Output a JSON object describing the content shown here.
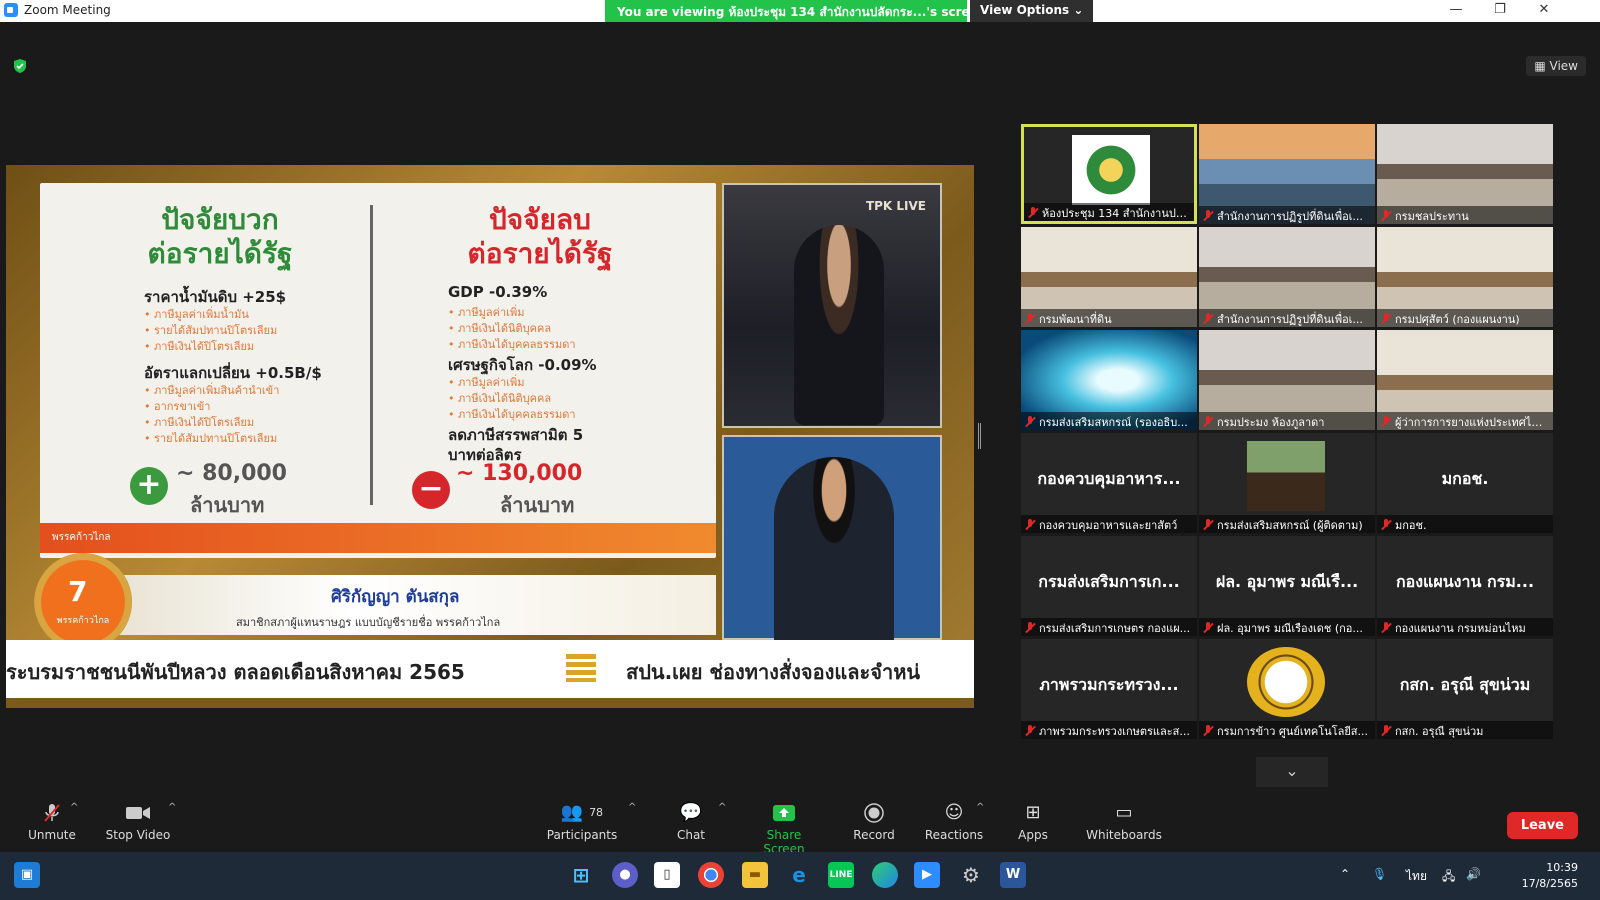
{
  "window": {
    "title": "Zoom Meeting"
  },
  "banner": {
    "message": "You are viewing ห้องประชุม 134 สำนักงานปลัดกระ...'s screen",
    "view_options": "View Options ⌄"
  },
  "view_button": "View",
  "slide": {
    "positive_heading_1": "ปัจจัยบวก",
    "positive_heading_2": "ต่อรายได้รัฐ",
    "negative_heading_1": "ปัจจัยลบ",
    "negative_heading_2": "ต่อรายได้รัฐ",
    "pos_item1": "ราคาน้ำมันดิบ +25$",
    "pos_item1_subs": [
      "• ภาษีมูลค่าเพิ่มน้ำมัน",
      "• รายได้สัมปทานปิโตรเลียม",
      "• ภาษีเงินได้ปิโตรเลียม"
    ],
    "pos_item2": "อัตราแลกเปลี่ยน +0.5B/$",
    "pos_item2_subs": [
      "• ภาษีมูลค่าเพิ่มสินค้านำเข้า",
      "• อากรขาเข้า",
      "• ภาษีเงินได้ปิโตรเลียม",
      "• รายได้สัมปทานปิโตรเลียม"
    ],
    "pos_total": "~ 80,000",
    "pos_unit": "ล้านบาท",
    "neg_item1": "GDP -0.39%",
    "neg_item1_subs": [
      "• ภาษีมูลค่าเพิ่ม",
      "• ภาษีเงินได้นิติบุคคล",
      "• ภาษีเงินได้บุคคลธรรมดา"
    ],
    "neg_item2": "เศรษฐกิจโลก -0.09%",
    "neg_item2_subs": [
      "• ภาษีมูลค่าเพิ่ม",
      "• ภาษีเงินได้นิติบุคคล",
      "• ภาษีเงินได้บุคคลธรรมดา"
    ],
    "neg_item3_line1": "ลดภาษีสรรพสามิต 5",
    "neg_item3_line2": "บาทต่อลิตร",
    "neg_total": "~ 130,000",
    "neg_unit": "ล้านบาท",
    "plus_sign": "+",
    "minus_sign": "−",
    "orange_bar_text": "พรรคก้าวไกล",
    "cam_tag": "TPK LIVE",
    "speaker_name": "ศิริกัญญา ตันสกุล",
    "speaker_title": "สมาชิกสภาผู้แทนราษฎร แบบบัญชีรายชื่อ พรรคก้าวไกล",
    "logo_text": "พรรคก้าวไกล",
    "logo_mark": "7",
    "ticker_left": "ระบรมราชชนนีพันปีหลวง ตลอดเดือนสิงหาคม 2565",
    "ticker_right": "สปน.เผย ช่องทางสั่งจองและจำหน่"
  },
  "participants": [
    {
      "label": "ห้องประชุม 134 สำนักงานปลัดก...",
      "big": "",
      "kind": "logo-green"
    },
    {
      "label": "สำนักงานการปฏิรูปที่ดินเพื่อเ...",
      "big": "",
      "kind": "video-person"
    },
    {
      "label": "กรมชลประทาน",
      "big": "",
      "kind": "video-room"
    },
    {
      "label": "กรมพัฒนาที่ดิน",
      "big": "",
      "kind": "video-room2"
    },
    {
      "label": "สำนักงานการปฏิรูปที่ดินเพื่อเ...",
      "big": "",
      "kind": "video-room"
    },
    {
      "label": "กรมปศุสัตว์ (กองแผนงาน)",
      "big": "",
      "kind": "video-room2"
    },
    {
      "label": "กรมส่งเสริมสหกรณ์ (รองอธิบ...",
      "big": "",
      "kind": "video-tunnel"
    },
    {
      "label": "กรมประมง ห้องภูลาดา",
      "big": "",
      "kind": "video-room"
    },
    {
      "label": "ผู้ว่าการการยางแห่งประเทศไท...",
      "big": "",
      "kind": "video-room2"
    },
    {
      "label": "กองควบคุมอาหารและยาสัตว์",
      "big": "กองควบคุมอาหาร...",
      "kind": "name"
    },
    {
      "label": "กรมส่งเสริมสหกรณ์ (ผู้ติดตาม)",
      "big": "",
      "kind": "plant"
    },
    {
      "label": "มกอช.",
      "big": "มกอช.",
      "kind": "name"
    },
    {
      "label": "กรมส่งเสริมการเกษตร กองแผ...",
      "big": "กรมส่งเสริมการเก...",
      "kind": "name"
    },
    {
      "label": "ฝล. อุมาพร มณีเรืองเดช (กอ...",
      "big": "ฝล. อุมาพร มณีเรื...",
      "kind": "name"
    },
    {
      "label": "กองแผนงาน กรมหม่อนไหม",
      "big": "กองแผนงาน กรม...",
      "kind": "name"
    },
    {
      "label": "ภาพรวมกระทรวงเกษตรและส...",
      "big": "ภาพรวมกระทรวง...",
      "kind": "name"
    },
    {
      "label": "กรมการข้าว ศูนย์เทคโนโลยีส...",
      "big": "",
      "kind": "logo-yellow"
    },
    {
      "label": "กสก. อรุณี สุขน่วม",
      "big": "กสก. อรุณี สุขน่วม",
      "kind": "name"
    }
  ],
  "toolbar": {
    "unmute": "Unmute",
    "stop_video": "Stop Video",
    "participants": "Participants",
    "participants_count": "78",
    "chat": "Chat",
    "share_screen": "Share Screen",
    "record": "Record",
    "reactions": "Reactions",
    "apps": "Apps",
    "whiteboards": "Whiteboards",
    "leave": "Leave"
  },
  "taskbar": {
    "time": "10:39",
    "date": "17/8/2565",
    "lang": "ไทย"
  },
  "colors": {
    "share_green": "#23c24b",
    "leave_red": "#e02828",
    "active_border": "#d4e157"
  }
}
